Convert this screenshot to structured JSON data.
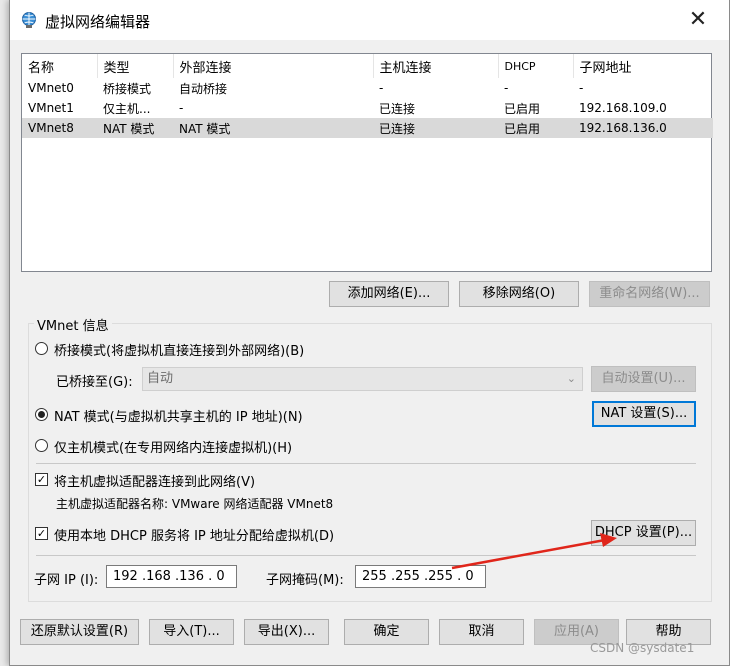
{
  "window": {
    "title": "虚拟网络编辑器",
    "close_symbol": "✕"
  },
  "table": {
    "headers": [
      "名称",
      "类型",
      "外部连接",
      "主机连接",
      "DHCP",
      "子网地址"
    ],
    "rows": [
      {
        "name": "VMnet0",
        "type": "桥接模式",
        "external": "自动桥接",
        "host": "-",
        "dhcp": "-",
        "subnet": "-"
      },
      {
        "name": "VMnet1",
        "type": "仅主机...",
        "external": "-",
        "host": "已连接",
        "dhcp": "已启用",
        "subnet": "192.168.109.0"
      },
      {
        "name": "VMnet8",
        "type": "NAT 模式",
        "external": "NAT 模式",
        "host": "已连接",
        "dhcp": "已启用",
        "subnet": "192.168.136.0",
        "selected": true
      }
    ]
  },
  "table_buttons": {
    "add": "添加网络(E)...",
    "remove": "移除网络(O)",
    "rename": "重命名网络(W)..."
  },
  "vmnet_info": {
    "group_label": "VMnet 信息",
    "bridge_radio": "桥接模式(将虚拟机直接连接到外部网络)(B)",
    "bridged_to_label": "已桥接至(G):",
    "bridged_to_value": "自动",
    "auto_settings": "自动设置(U)...",
    "nat_radio": "NAT 模式(与虚拟机共享主机的 IP 地址)(N)",
    "nat_settings": "NAT 设置(S)...",
    "hostonly_radio": "仅主机模式(在专用网络内连接虚拟机)(H)",
    "connect_adapter": "将主机虚拟适配器连接到此网络(V)",
    "adapter_name": "主机虚拟适配器名称: VMware 网络适配器 VMnet8",
    "use_dhcp": "使用本地 DHCP 服务将 IP 地址分配给虚拟机(D)",
    "dhcp_settings": "DHCP 设置(P)...",
    "subnet_ip_label": "子网 IP (I):",
    "subnet_ip_value": "192 .168 .136 .  0",
    "subnet_mask_label": "子网掩码(M):",
    "subnet_mask_value": "255 .255 .255 .  0"
  },
  "bottom_buttons": {
    "restore": "还原默认设置(R)",
    "import": "导入(T)...",
    "export": "导出(X)...",
    "ok": "确定",
    "cancel": "取消",
    "apply": "应用(A)",
    "help": "帮助"
  },
  "watermark": "CSDN @sysdate1",
  "colors": {
    "accent": "#0078d7",
    "annotation_arrow": "#e0261b",
    "selected_row": "#d9d9d9"
  }
}
